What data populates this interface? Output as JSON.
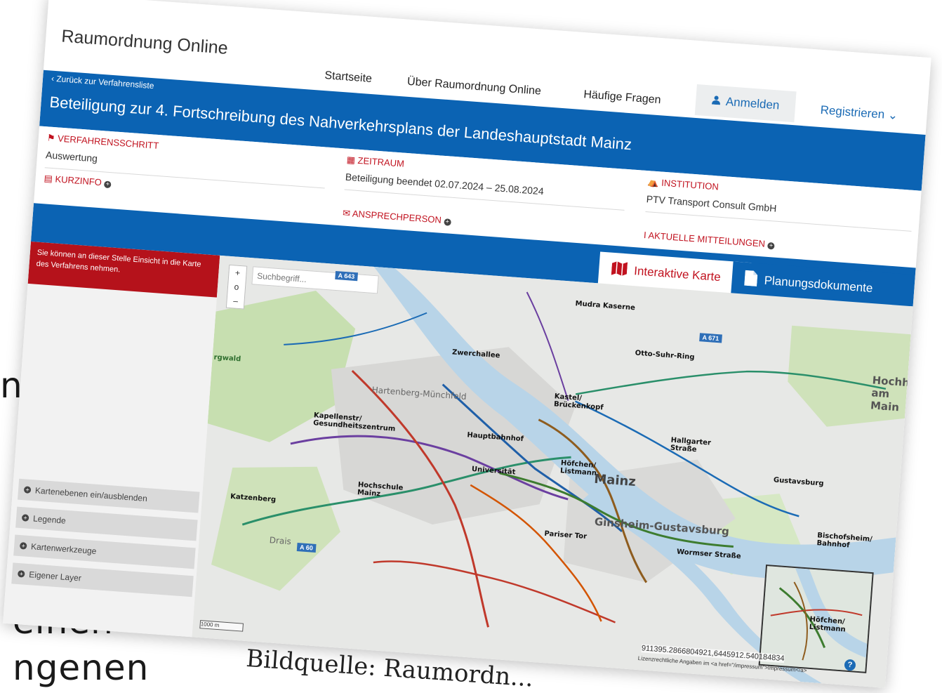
{
  "background": {
    "fragment_top": "nnten",
    "fragment_bottom1": "einen",
    "fragment_bottom2": "ngenen",
    "caption": "Bildquelle: Raumordn..."
  },
  "header": {
    "brand": "Raumordnung Online",
    "nav": [
      "Startseite",
      "Über Raumordnung Online",
      "Häufige Fragen"
    ],
    "login_label": "Anmelden",
    "register_label": "Registrieren"
  },
  "procedure": {
    "back_link": "‹ Zurück zur Verfahrensliste",
    "title": "Beteiligung zur 4. Fortschreibung des Nahverkehrsplans der Landeshauptstadt Mainz",
    "step_label": "VERFAHRENSSCHRITT",
    "step_value": "Auswertung",
    "period_label": "ZEITRAUM",
    "period_value": "Beteiligung beendet  02.07.2024 – 25.08.2024",
    "institution_label": "INSTITUTION",
    "institution_value": "PTV Transport Consult GmbH",
    "kurzinfo_label": "KURZINFO",
    "contact_label": "ANSPRECHPERSON",
    "news_label": "AKTUELLE MITTEILUNGEN"
  },
  "tabs": [
    {
      "label": "Interaktive Karte",
      "active": true
    },
    {
      "label": "Planungsdokumente",
      "active": false
    }
  ],
  "sidebar": {
    "notice": "Sie können an dieser Stelle Einsicht in die Karte des Verfahrens nehmen.",
    "panels": [
      "Kartenebenen ein/ausblenden",
      "Legende",
      "Kartenwerkzeuge",
      "Eigener Layer"
    ]
  },
  "map": {
    "search_placeholder": "Suchbegriff...",
    "zoom": [
      "+",
      "o",
      "–"
    ],
    "labels": [
      "Mudra Kaserne",
      "Otto-Suhr-Ring",
      "Zwerchallee",
      "Hartenberg-Münchfeld",
      "Kastel/ Brückenkopf",
      "Kapellenstr/ Gesundheitszentrum",
      "Hauptbahnhof",
      "Hallgarter Straße",
      "Höfchen/ Listmann",
      "Mainz",
      "Universität",
      "Gustavsburg",
      "Hochschule Mainz",
      "Katzenberg",
      "Ginsheim-Gustavsburg",
      "Pariser Tor",
      "Wormser Straße",
      "Bischofsheim/ Bahnhof",
      "Drais",
      "Hochheim am Main",
      "rgwald"
    ],
    "shields": [
      "A 643",
      "A 671",
      "A 60"
    ],
    "scale": "1000 m",
    "coordinates": "911395.2866804921,6445912.540184834",
    "license": "Lizenzrechtliche Angaben im <a href=\"/impressum\">Impressum</a>"
  },
  "colors": {
    "brand_blue": "#0b63b3",
    "alert_red": "#b5121b",
    "river": "#b8d4e8",
    "green": "#c7dfb0"
  }
}
